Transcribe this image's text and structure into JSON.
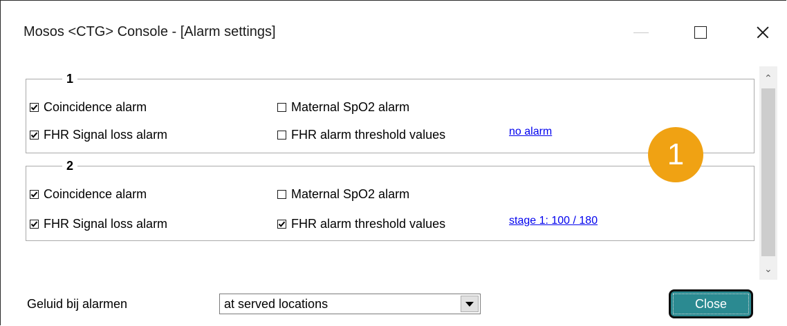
{
  "window": {
    "title": "Mosos <CTG> Console - [Alarm settings]"
  },
  "groups": [
    {
      "title": "1",
      "coincidence": {
        "label": "Coincidence alarm",
        "checked": true
      },
      "signal_loss": {
        "label": "FHR Signal loss alarm",
        "checked": true
      },
      "spo2": {
        "label": "Maternal SpO2 alarm",
        "checked": false
      },
      "threshold": {
        "label": "FHR alarm threshold values",
        "checked": false
      },
      "threshold_link": "no alarm"
    },
    {
      "title": "2",
      "coincidence": {
        "label": "Coincidence alarm",
        "checked": true
      },
      "signal_loss": {
        "label": "FHR Signal loss alarm",
        "checked": true
      },
      "spo2": {
        "label": "Maternal SpO2 alarm",
        "checked": false
      },
      "threshold": {
        "label": "FHR alarm threshold values",
        "checked": true
      },
      "threshold_link": "stage 1: 100 / 180"
    }
  ],
  "sound": {
    "label": "Geluid bij alarmen",
    "selected": "at served locations"
  },
  "buttons": {
    "close": "Close"
  },
  "badge": "1",
  "colors": {
    "link": "#0000ee",
    "close_button": "#2b8a91",
    "badge": "#f0a213"
  }
}
